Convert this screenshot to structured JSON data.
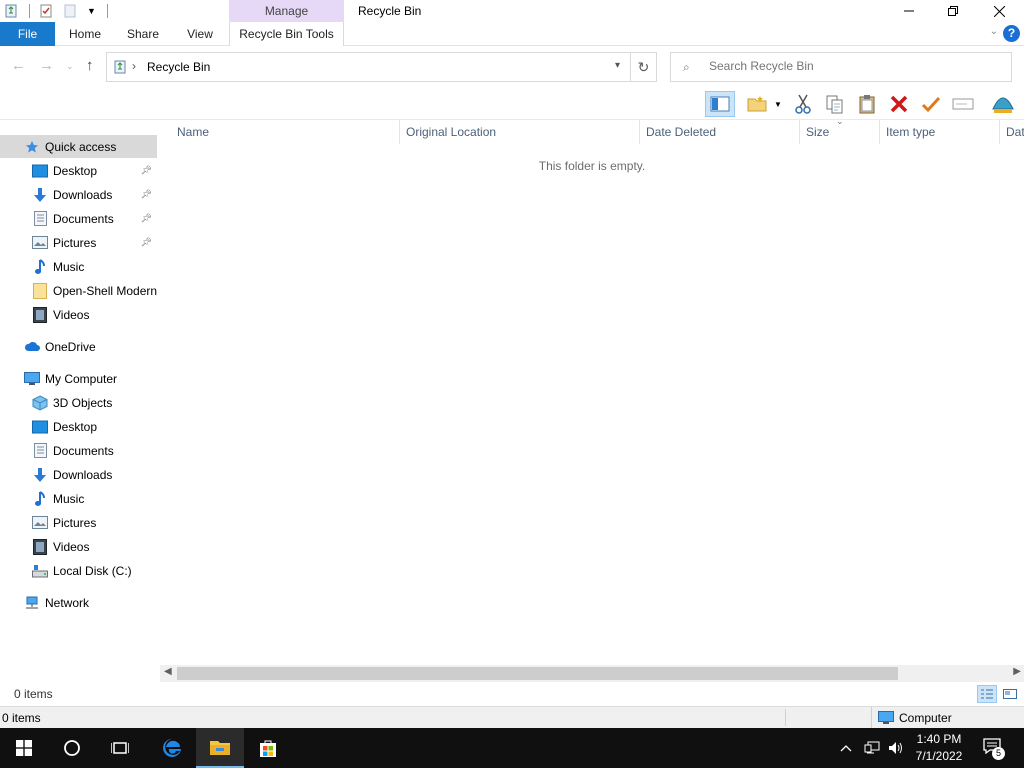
{
  "window": {
    "title": "Recycle Bin",
    "context_tab_group": "Manage",
    "controls": {
      "minimize": "minimize-icon",
      "restore": "restore-icon",
      "close": "close-icon"
    }
  },
  "ribbon": {
    "tabs": [
      "File",
      "Home",
      "Share",
      "View",
      "Recycle Bin Tools"
    ],
    "help": "?"
  },
  "address": {
    "path": "Recycle Bin",
    "search_placeholder": "Search Recycle Bin"
  },
  "toolbar": {
    "buttons": [
      "preview-pane-icon",
      "new-folder-icon",
      "cut-icon",
      "copy-icon",
      "paste-icon",
      "delete-icon",
      "select-icon",
      "rename-icon",
      "properties-icon"
    ]
  },
  "navigation": {
    "quick_access": {
      "label": "Quick access",
      "items": [
        "Desktop",
        "Downloads",
        "Documents",
        "Pictures",
        "Music",
        "Open-Shell Modern",
        "Videos"
      ]
    },
    "onedrive": "OneDrive",
    "computer": {
      "label": "My Computer",
      "items": [
        "3D Objects",
        "Desktop",
        "Documents",
        "Downloads",
        "Music",
        "Pictures",
        "Videos",
        "Local Disk (C:)"
      ]
    },
    "network": "Network"
  },
  "columns": [
    "Name",
    "Original Location",
    "Date Deleted",
    "Size",
    "Item type",
    "Dat"
  ],
  "empty_message": "This folder is empty.",
  "status": {
    "item_count": "0 items",
    "bottom_count": "0 items",
    "zone": "Computer"
  },
  "taskbar": {
    "time": "1:40 PM",
    "date": "7/1/2022",
    "notification_count": "5",
    "apps": [
      "start-icon",
      "search-icon",
      "task-view-icon",
      "edge-icon",
      "file-explorer-icon",
      "store-icon"
    ]
  }
}
